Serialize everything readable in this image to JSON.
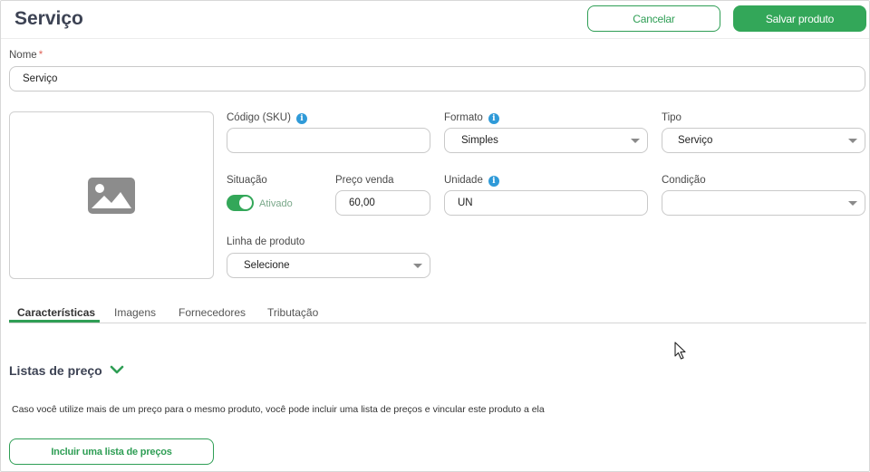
{
  "header": {
    "title": "Serviço",
    "cancel_label": "Cancelar",
    "save_label": "Salvar produto"
  },
  "form": {
    "name": {
      "label": "Nome",
      "required_mark": "*",
      "value": "Serviço"
    },
    "sku": {
      "label": "Código (SKU)",
      "value": ""
    },
    "formato": {
      "label": "Formato",
      "value": "Simples"
    },
    "tipo": {
      "label": "Tipo",
      "value": "Serviço"
    },
    "situacao": {
      "label": "Situação",
      "state": "Ativado",
      "on": true
    },
    "preco_venda": {
      "label": "Preço venda",
      "value": "60,00"
    },
    "unidade": {
      "label": "Unidade",
      "value": "UN"
    },
    "condicao": {
      "label": "Condição",
      "value": ""
    },
    "linha_produto": {
      "label": "Linha de produto",
      "value": "Selecione"
    }
  },
  "icons": {
    "info": "info-icon",
    "image_placeholder": "image-placeholder-icon",
    "chevron": "chevron-down-icon",
    "cursor": "mouse-cursor-icon"
  },
  "tabs": [
    {
      "label": "Características",
      "active": true
    },
    {
      "label": "Imagens",
      "active": false
    },
    {
      "label": "Fornecedores",
      "active": false
    },
    {
      "label": "Tributação",
      "active": false
    }
  ],
  "price_lists": {
    "title": "Listas de preço",
    "description": "Caso você utilize mais de um preço para o mesmo produto, você pode incluir uma lista de preços e vincular este produto a ela",
    "button_label": "Incluir uma lista de preços"
  },
  "colors": {
    "accent": "#33a759",
    "info": "#2f9ad8",
    "title": "#3d4354"
  }
}
